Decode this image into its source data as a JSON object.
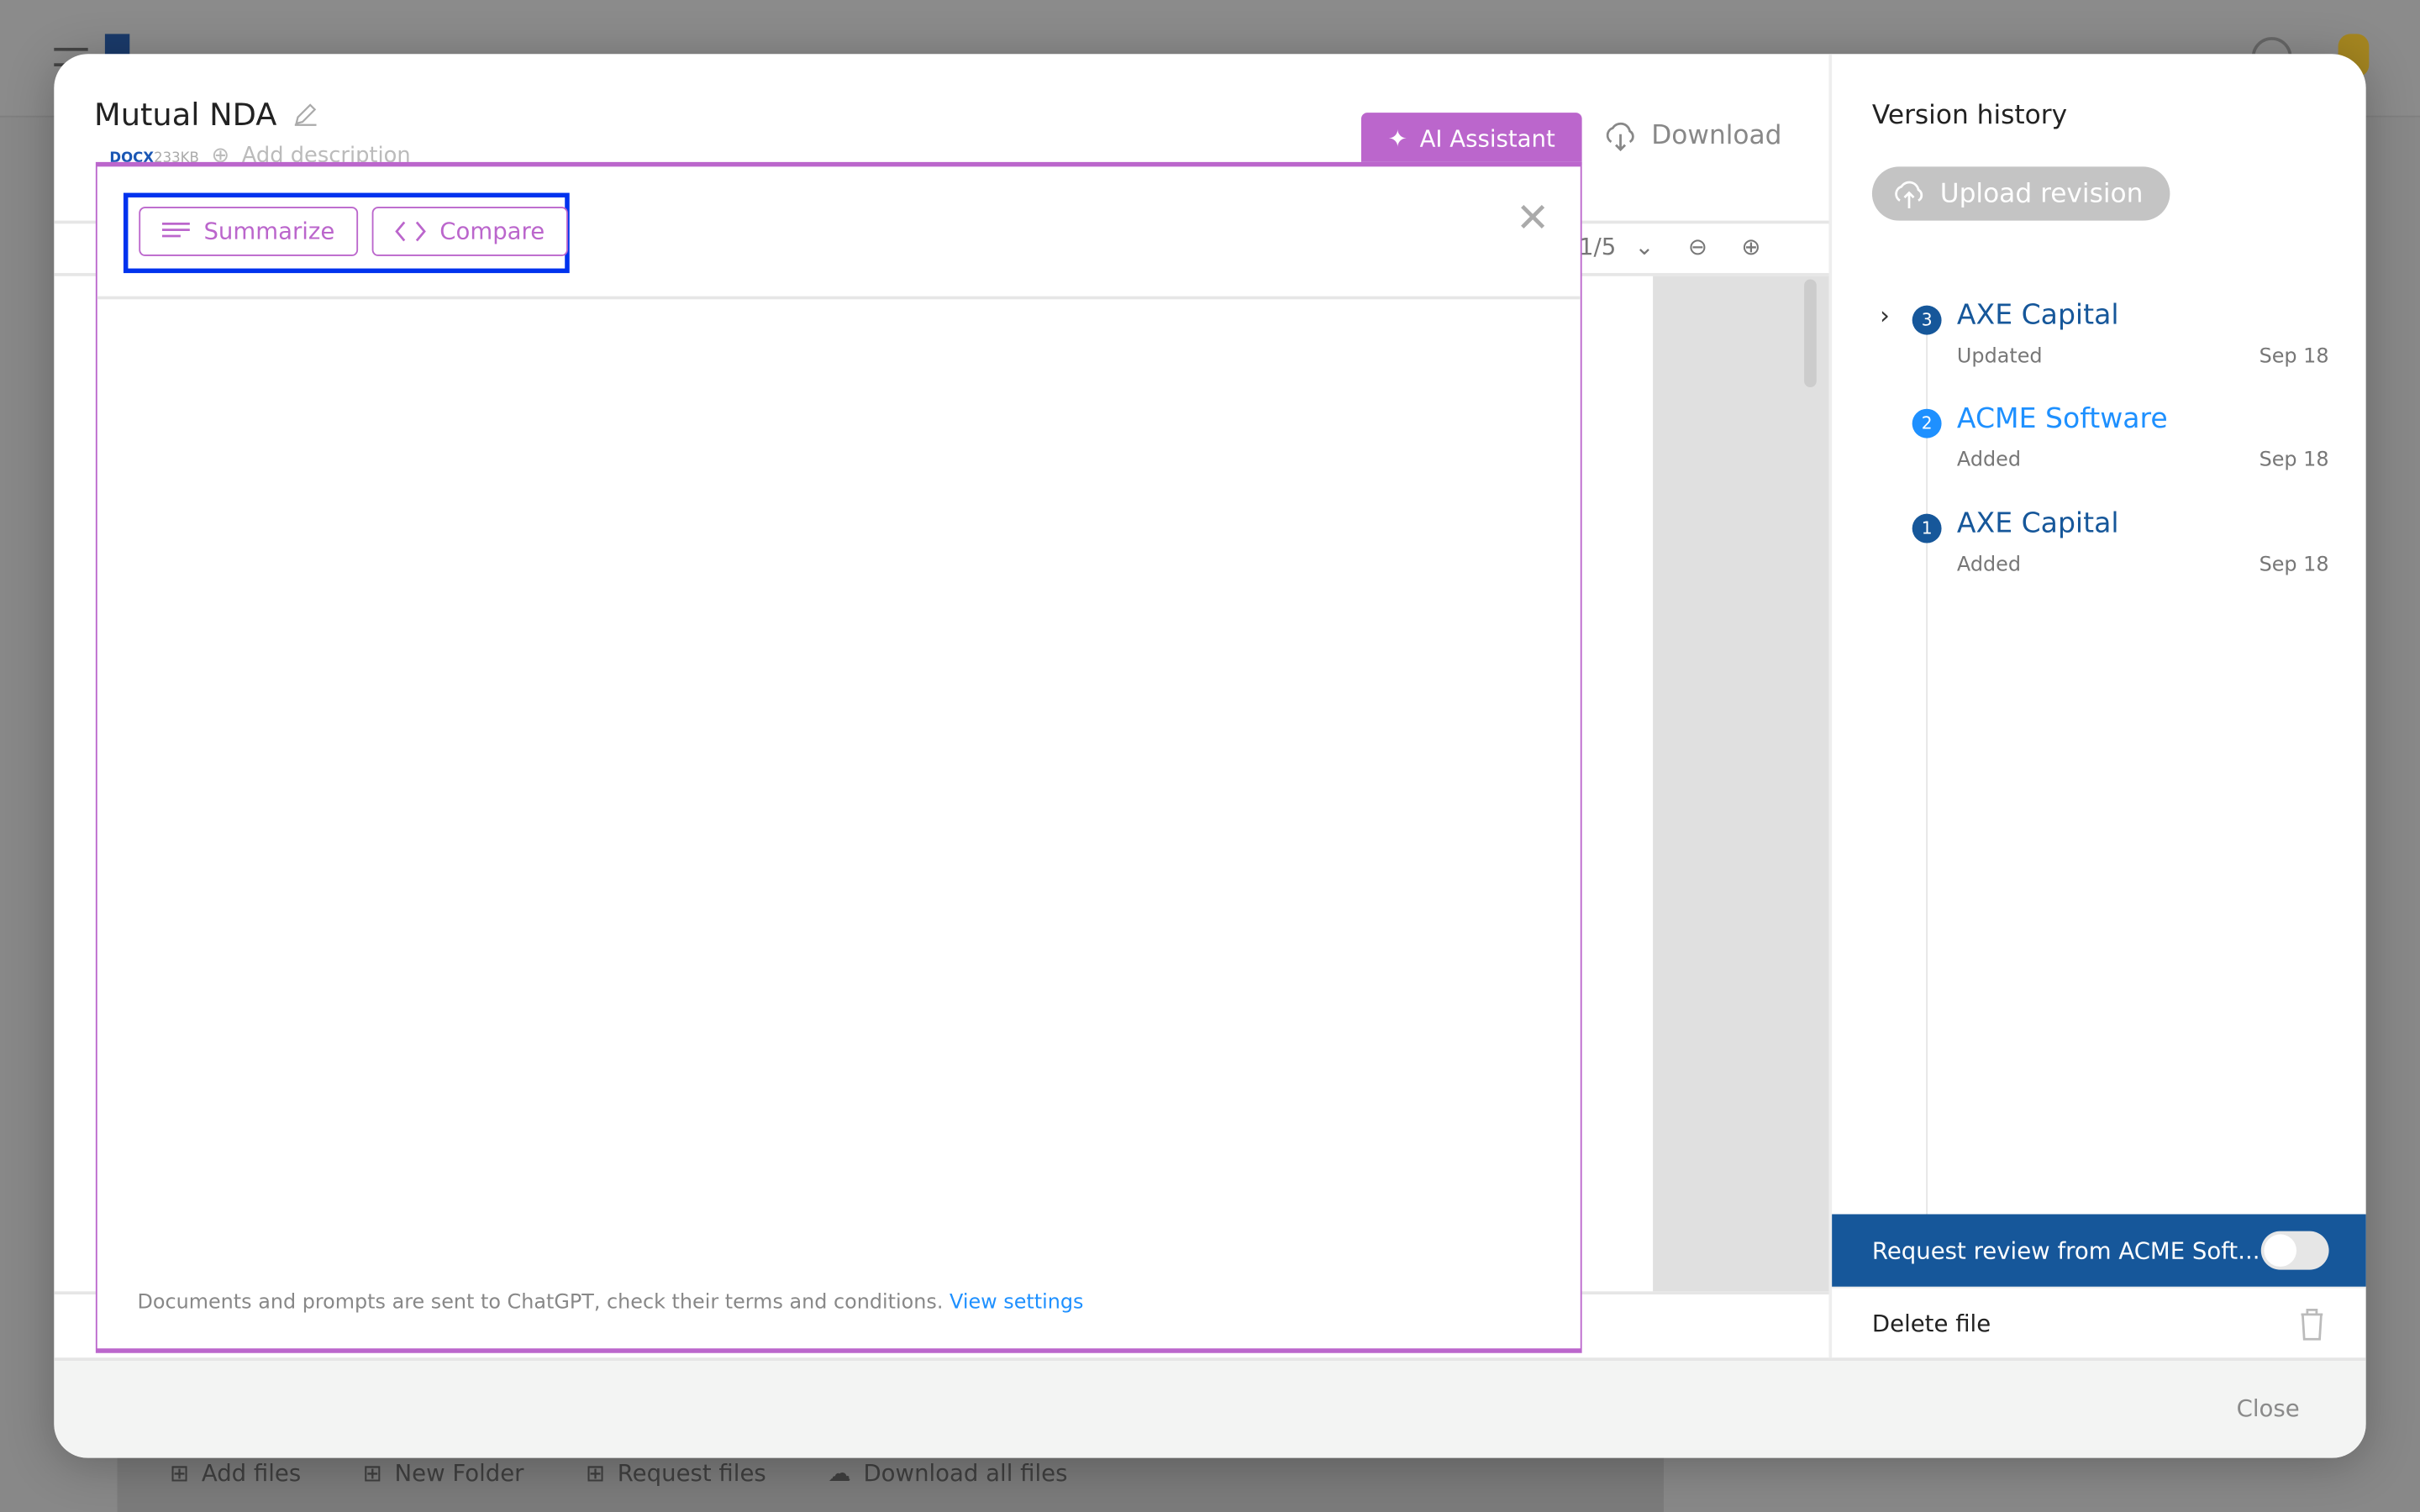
{
  "background": {
    "bottom_bar": [
      "Add files",
      "New Folder",
      "Request files",
      "Download all files"
    ]
  },
  "document": {
    "title": "Mutual NDA",
    "file_type": "DOCX",
    "file_size": "233KB",
    "add_description": "Add description",
    "ai_assistant_label": "AI Assistant",
    "download_label": "Download",
    "page_indicator": "1/5"
  },
  "ai_panel": {
    "summarize_label": "Summarize",
    "compare_label": "Compare",
    "disclaimer": "Documents and prompts are sent to ChatGPT, check their terms and conditions.",
    "view_settings_label": "View settings"
  },
  "version_history": {
    "title": "Version history",
    "upload_label": "Upload revision",
    "versions": [
      {
        "number": "3",
        "name": "AXE Capital",
        "status": "Updated",
        "date": "Sep 18",
        "color": "#16579a"
      },
      {
        "number": "2",
        "name": "ACME Software",
        "status": "Added",
        "date": "Sep 18",
        "color": "#1e90ff"
      },
      {
        "number": "1",
        "name": "AXE Capital",
        "status": "Added",
        "date": "Sep 18",
        "color": "#16579a"
      }
    ],
    "request_review_label": "Request review from ACME Soft...",
    "request_review_enabled": false,
    "delete_label": "Delete file"
  },
  "footer": {
    "close_label": "Close"
  },
  "colors": {
    "accent": "#bb66cc",
    "primary": "#16579a",
    "link": "#1e90ff",
    "focus": "#0033ee"
  }
}
